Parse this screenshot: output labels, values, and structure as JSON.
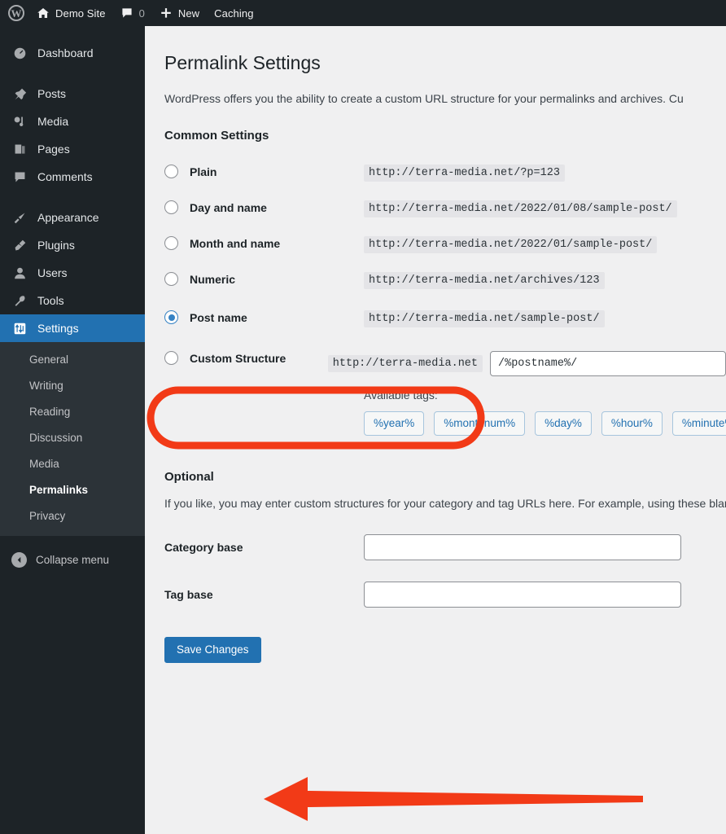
{
  "adminbar": {
    "logo_title": "About WordPress",
    "site_name": "Demo Site",
    "comments_count": "0",
    "new_label": "New",
    "caching_label": "Caching"
  },
  "sidebar": {
    "items": [
      {
        "label": "Dashboard",
        "icon": "dashboard-icon"
      },
      {
        "label": "Posts",
        "icon": "pin-icon"
      },
      {
        "label": "Media",
        "icon": "media-icon"
      },
      {
        "label": "Pages",
        "icon": "pages-icon"
      },
      {
        "label": "Comments",
        "icon": "comments-icon"
      },
      {
        "label": "Appearance",
        "icon": "brush-icon"
      },
      {
        "label": "Plugins",
        "icon": "plug-icon"
      },
      {
        "label": "Users",
        "icon": "user-icon"
      },
      {
        "label": "Tools",
        "icon": "wrench-icon"
      },
      {
        "label": "Settings",
        "icon": "settings-icon"
      }
    ],
    "submenu": [
      {
        "label": "General",
        "active": false
      },
      {
        "label": "Writing",
        "active": false
      },
      {
        "label": "Reading",
        "active": false
      },
      {
        "label": "Discussion",
        "active": false
      },
      {
        "label": "Media",
        "active": false
      },
      {
        "label": "Permalinks",
        "active": true
      },
      {
        "label": "Privacy",
        "active": false
      }
    ],
    "collapse_label": "Collapse menu"
  },
  "page": {
    "title": "Permalink Settings",
    "intro": "WordPress offers you the ability to create a custom URL structure for your permalinks and archives. Cu",
    "common_settings_heading": "Common Settings",
    "available_tags_label": "Available tags:"
  },
  "options": [
    {
      "label": "Plain",
      "url": "http://terra-media.net/?p=123",
      "selected": false
    },
    {
      "label": "Day and name",
      "url": "http://terra-media.net/2022/01/08/sample-post/",
      "selected": false
    },
    {
      "label": "Month and name",
      "url": "http://terra-media.net/2022/01/sample-post/",
      "selected": false
    },
    {
      "label": "Numeric",
      "url": "http://terra-media.net/archives/123",
      "selected": false
    },
    {
      "label": "Post name",
      "url": "http://terra-media.net/sample-post/",
      "selected": true
    },
    {
      "label": "Custom Structure",
      "url": "http://terra-media.net",
      "selected": false,
      "input_value": "/%postname%/"
    }
  ],
  "tags": [
    {
      "label": "%year%"
    },
    {
      "label": "%monthnum%"
    },
    {
      "label": "%day%"
    },
    {
      "label": "%hour%"
    },
    {
      "label": "%minute%"
    }
  ],
  "optional": {
    "heading": "Optional",
    "text": "If you like, you may enter custom structures for your category and tag URLs here. For example, using these blank the defaults will be used.",
    "category_base_label": "Category base",
    "category_base_value": "",
    "tag_base_label": "Tag base",
    "tag_base_value": "",
    "save_label": "Save Changes"
  },
  "annotations": {
    "highlight_color": "#f23a17",
    "ellipse_target": "Post name",
    "arrow_target": "Save Changes"
  },
  "colors": {
    "admin_blue": "#2271b1",
    "sidebar_dark": "#1d2327",
    "submenu_dark": "#2c3338",
    "content_bg": "#f0f0f1",
    "annotation_red": "#f23a17"
  }
}
